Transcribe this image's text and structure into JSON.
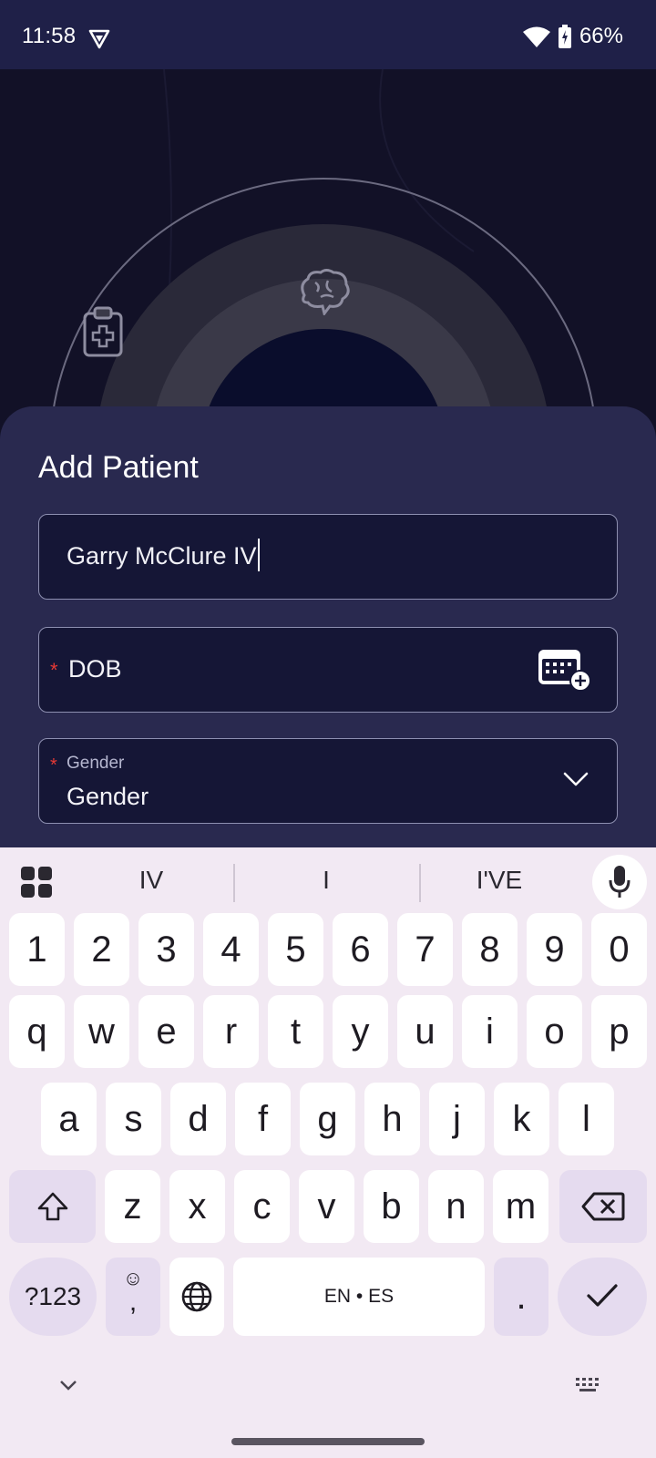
{
  "status_bar": {
    "time": "11:58",
    "battery": "66%",
    "icons": [
      "vpn-shield-icon",
      "wifi-icon",
      "battery-charging-icon"
    ]
  },
  "hero": {
    "icons": [
      "clipboard-medical-icon",
      "brain-icon"
    ]
  },
  "form": {
    "title": "Add Patient",
    "name_value": "Garry McClure IV",
    "dob_label": "DOB",
    "gender_label_small": "Gender",
    "gender_value": "Gender",
    "required_mark": "*"
  },
  "keyboard": {
    "suggestions": [
      "IV",
      "I",
      "I'VE"
    ],
    "row_numbers": [
      "1",
      "2",
      "3",
      "4",
      "5",
      "6",
      "7",
      "8",
      "9",
      "0"
    ],
    "row_1": [
      "q",
      "w",
      "e",
      "r",
      "t",
      "y",
      "u",
      "i",
      "o",
      "p"
    ],
    "row_2": [
      "a",
      "s",
      "d",
      "f",
      "g",
      "h",
      "j",
      "k",
      "l"
    ],
    "row_3": [
      "z",
      "x",
      "c",
      "v",
      "b",
      "n",
      "m"
    ],
    "symbols_label": "?123",
    "emoji_comma_top": "☺",
    "emoji_comma_bottom": ",",
    "space_label": "EN • ES",
    "period_label": "."
  },
  "colors": {
    "status_bar": "#1f2048",
    "sheet": "#29294f",
    "field_bg": "#151636",
    "required": "#e53935",
    "keyboard_bg": "#f2e9f3"
  }
}
